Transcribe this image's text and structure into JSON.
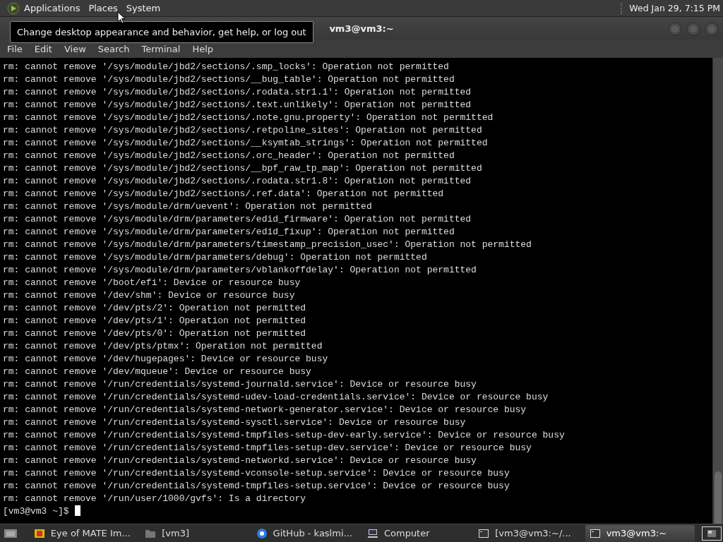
{
  "top_panel": {
    "menus": [
      "Applications",
      "Places",
      "System"
    ],
    "clock": "Wed Jan 29,  7:15 PM"
  },
  "tooltip": "Change desktop appearance and behavior, get help, or log out",
  "window": {
    "title": "vm3@vm3:~"
  },
  "menu_bar": [
    "File",
    "Edit",
    "View",
    "Search",
    "Terminal",
    "Help"
  ],
  "terminal": {
    "lines": [
      "rm: cannot remove '/sys/module/jbd2/sections/.smp_locks': Operation not permitted",
      "rm: cannot remove '/sys/module/jbd2/sections/__bug_table': Operation not permitted",
      "rm: cannot remove '/sys/module/jbd2/sections/.rodata.str1.1': Operation not permitted",
      "rm: cannot remove '/sys/module/jbd2/sections/.text.unlikely': Operation not permitted",
      "rm: cannot remove '/sys/module/jbd2/sections/.note.gnu.property': Operation not permitted",
      "rm: cannot remove '/sys/module/jbd2/sections/.retpoline_sites': Operation not permitted",
      "rm: cannot remove '/sys/module/jbd2/sections/__ksymtab_strings': Operation not permitted",
      "rm: cannot remove '/sys/module/jbd2/sections/.orc_header': Operation not permitted",
      "rm: cannot remove '/sys/module/jbd2/sections/__bpf_raw_tp_map': Operation not permitted",
      "rm: cannot remove '/sys/module/jbd2/sections/.rodata.str1.8': Operation not permitted",
      "rm: cannot remove '/sys/module/jbd2/sections/.ref.data': Operation not permitted",
      "rm: cannot remove '/sys/module/drm/uevent': Operation not permitted",
      "rm: cannot remove '/sys/module/drm/parameters/edid_firmware': Operation not permitted",
      "rm: cannot remove '/sys/module/drm/parameters/edid_fixup': Operation not permitted",
      "rm: cannot remove '/sys/module/drm/parameters/timestamp_precision_usec': Operation not permitted",
      "rm: cannot remove '/sys/module/drm/parameters/debug': Operation not permitted",
      "rm: cannot remove '/sys/module/drm/parameters/vblankoffdelay': Operation not permitted",
      "rm: cannot remove '/boot/efi': Device or resource busy",
      "rm: cannot remove '/dev/shm': Device or resource busy",
      "rm: cannot remove '/dev/pts/2': Operation not permitted",
      "rm: cannot remove '/dev/pts/1': Operation not permitted",
      "rm: cannot remove '/dev/pts/0': Operation not permitted",
      "rm: cannot remove '/dev/pts/ptmx': Operation not permitted",
      "rm: cannot remove '/dev/hugepages': Device or resource busy",
      "rm: cannot remove '/dev/mqueue': Device or resource busy",
      "rm: cannot remove '/run/credentials/systemd-journald.service': Device or resource busy",
      "rm: cannot remove '/run/credentials/systemd-udev-load-credentials.service': Device or resource busy",
      "rm: cannot remove '/run/credentials/systemd-network-generator.service': Device or resource busy",
      "rm: cannot remove '/run/credentials/systemd-sysctl.service': Device or resource busy",
      "rm: cannot remove '/run/credentials/systemd-tmpfiles-setup-dev-early.service': Device or resource busy",
      "rm: cannot remove '/run/credentials/systemd-tmpfiles-setup-dev.service': Device or resource busy",
      "rm: cannot remove '/run/credentials/systemd-networkd.service': Device or resource busy",
      "rm: cannot remove '/run/credentials/systemd-vconsole-setup.service': Device or resource busy",
      "rm: cannot remove '/run/credentials/systemd-tmpfiles-setup.service': Device or resource busy",
      "rm: cannot remove '/run/user/1000/gvfs': Is a directory"
    ],
    "prompt": "[vm3@vm3 ~]$"
  },
  "taskbar": {
    "items": [
      {
        "kind": "image",
        "label": "Eye of MATE Im...",
        "selected": false
      },
      {
        "kind": "folder",
        "label": "[vm3]",
        "selected": false
      },
      {
        "kind": "browser",
        "label": "GitHub - kaslmi...",
        "selected": false
      },
      {
        "kind": "computer",
        "label": "Computer",
        "selected": false
      },
      {
        "kind": "terminal",
        "label": "[vm3@vm3:~/...",
        "selected": false
      },
      {
        "kind": "terminal",
        "label": "vm3@vm3:~",
        "selected": true
      }
    ]
  }
}
